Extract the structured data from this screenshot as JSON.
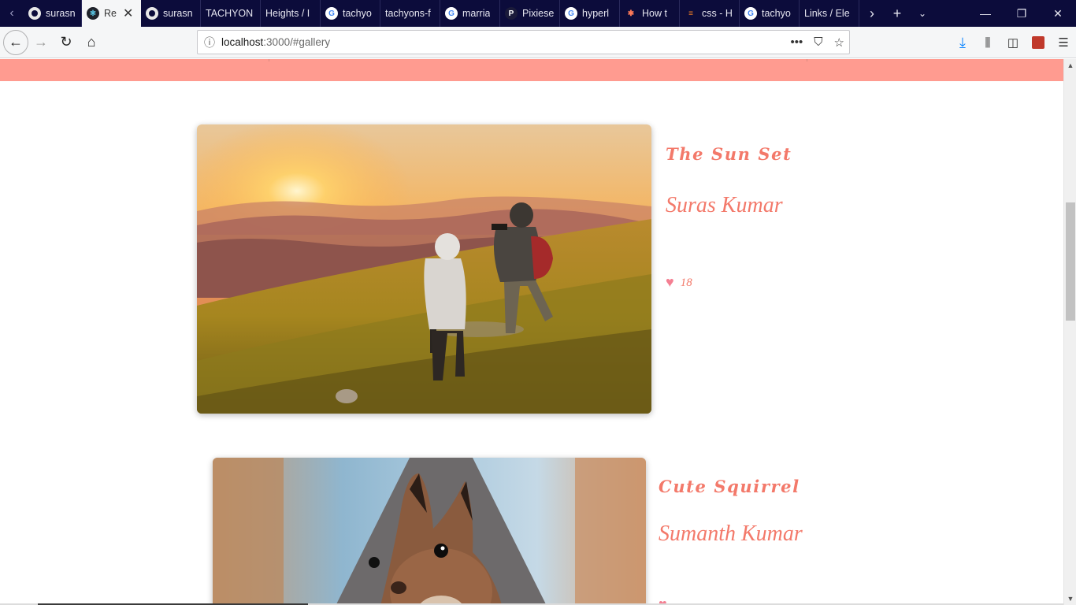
{
  "browser": {
    "tabs": [
      {
        "label": "surasn",
        "favicon": "github-icon"
      },
      {
        "label": "Re",
        "favicon": "react-icon",
        "active": true
      },
      {
        "label": "surasn",
        "favicon": "github-icon"
      },
      {
        "label": "TACHYON",
        "favicon": ""
      },
      {
        "label": "Heights / I",
        "favicon": ""
      },
      {
        "label": "tachyo",
        "favicon": "google-icon"
      },
      {
        "label": "tachyons-f",
        "favicon": ""
      },
      {
        "label": "marria",
        "favicon": "google-icon"
      },
      {
        "label": "Pixiese",
        "favicon": "pixies-icon"
      },
      {
        "label": "hyperl",
        "favicon": "google-icon"
      },
      {
        "label": "How t",
        "favicon": "hubspot-icon"
      },
      {
        "label": "css - H",
        "favicon": "stackoverflow-icon"
      },
      {
        "label": "tachyo",
        "favicon": "google-icon"
      },
      {
        "label": "Links / Ele",
        "favicon": ""
      }
    ],
    "url": {
      "host": "localhost",
      "rest": ":3000/#gallery"
    }
  },
  "gallery": {
    "items": [
      {
        "title": "The Sun Set",
        "author": "Suras Kumar",
        "likes": "18"
      },
      {
        "title": "Cute Squirrel",
        "author": "Sumanth Kumar",
        "likes": ""
      }
    ]
  },
  "colors": {
    "accent": "#f3796a",
    "band": "#ff9b90",
    "heart": "#f47f92",
    "tabstrip": "#0c0c3b"
  }
}
